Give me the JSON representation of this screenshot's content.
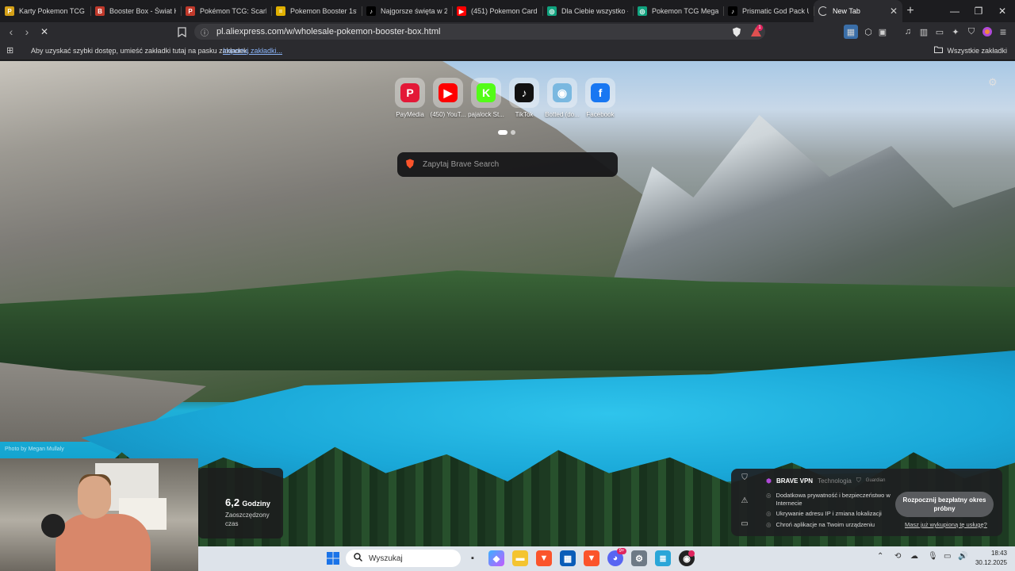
{
  "tabs": [
    {
      "title": "Karty Pokemon TCG Bi",
      "fav": "P",
      "color": "#d4a017"
    },
    {
      "title": "Booster Box - Świat Ka",
      "fav": "B",
      "color": "#c0392b"
    },
    {
      "title": "Pokémon TCG: Scarlet",
      "fav": "P",
      "color": "#c0392b"
    },
    {
      "title": "Pokemon Booster 1st E",
      "fav": "=",
      "color": "#e0b000"
    },
    {
      "title": "Najgorsze święta w 20",
      "fav": "♪",
      "color": "#000000"
    },
    {
      "title": "(451) Pokemon Card C",
      "fav": "▶",
      "color": "#ff0000"
    },
    {
      "title": "Dla Ciebie wszystko - s",
      "fav": "◎",
      "color": "#10a37f"
    },
    {
      "title": "Pokemon TCG Mega E",
      "fav": "◎",
      "color": "#10a37f"
    },
    {
      "title": "Prismatic God Pack Un",
      "fav": "♪",
      "color": "#000000"
    }
  ],
  "active_tab": {
    "title": "New Tab",
    "close": "✕"
  },
  "new_tab_symbol": "+",
  "window_controls": {
    "minimize": "—",
    "restore": "❐",
    "close": "✕"
  },
  "toolbar": {
    "url": "pl.aliexpress.com/w/wholesale-pokemon-booster-box.html",
    "back": "‹",
    "forward": "›",
    "reload": "✕",
    "shields_count": "1"
  },
  "bookmarks_bar": {
    "message": "Aby uzyskać szybki dostęp, umieść zakładki tutaj na pasku zakładek.",
    "import_link": "Importuj zakładki...",
    "all_bookmarks": "Wszystkie zakładki"
  },
  "top_sites": [
    {
      "label": "PayMedia",
      "glyph": "P",
      "color": "#e31837"
    },
    {
      "label": "(450) YouT...",
      "glyph": "▶",
      "color": "#ff0000"
    },
    {
      "label": "pajalock St...",
      "glyph": "K",
      "color": "#53fc18"
    },
    {
      "label": "TikTok",
      "glyph": "♪",
      "color": "#111111"
    },
    {
      "label": "Botted (do...",
      "glyph": "◉",
      "color": "#7ab8e0"
    },
    {
      "label": "Facebook",
      "glyph": "f",
      "color": "#1877f2"
    }
  ],
  "search": {
    "placeholder": "Zapytaj Brave Search"
  },
  "photo_credit": "Photo by Megan Mullaly",
  "stats": {
    "value": "6,2",
    "unit": "Godziny",
    "label": "Zaoszczędzony czas"
  },
  "vpn": {
    "brand": "BRAVE VPN",
    "tech": "Technologia",
    "partner": "Guardian",
    "features": [
      "Dodatkowa prywatność i bezpieczeństwo w Internecie",
      "Ukrywanie adresu IP i zmiana lokalizacji",
      "Chroń aplikacje na Twoim urządzeniu"
    ],
    "cta": "Rozpocznij bezpłatny okres próbny",
    "already": "Masz już wykupioną tę usługę?"
  },
  "taskbar": {
    "search_placeholder": "Wyszukaj",
    "time": "18:43",
    "date": "30.12.2025",
    "discord_badge": "9+"
  }
}
